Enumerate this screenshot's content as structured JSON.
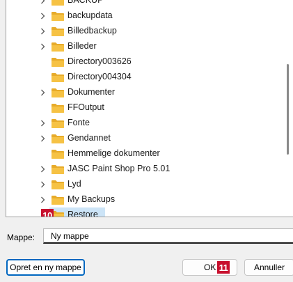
{
  "tree": {
    "items": [
      {
        "label": "BACKUP",
        "expandable": true
      },
      {
        "label": "backupdata",
        "expandable": true
      },
      {
        "label": "Billedbackup",
        "expandable": true
      },
      {
        "label": "Billeder",
        "expandable": true
      },
      {
        "label": "Directory003626",
        "expandable": false
      },
      {
        "label": "Directory004304",
        "expandable": false
      },
      {
        "label": "Dokumenter",
        "expandable": true
      },
      {
        "label": "FFOutput",
        "expandable": false
      },
      {
        "label": "Fonte",
        "expandable": true
      },
      {
        "label": "Gendannet",
        "expandable": true
      },
      {
        "label": "Hemmelige dokumenter",
        "expandable": false
      },
      {
        "label": "JASC Paint Shop Pro 5.01",
        "expandable": true
      },
      {
        "label": "Lyd",
        "expandable": true
      },
      {
        "label": "My Backups",
        "expandable": true
      },
      {
        "label": "Restore",
        "expandable": false,
        "selected": true
      }
    ]
  },
  "badges": {
    "restore": "10",
    "ok": "11"
  },
  "folder_field": {
    "label": "Mappe:",
    "value": "Ny mappe"
  },
  "buttons": {
    "new_folder": "Opret en ny mappe",
    "ok": "OK",
    "cancel": "Annuller"
  },
  "colors": {
    "folder": "#f6c244",
    "selection": "#cce4f7",
    "badge": "#c8102e",
    "focus_border": "#0067c0"
  }
}
